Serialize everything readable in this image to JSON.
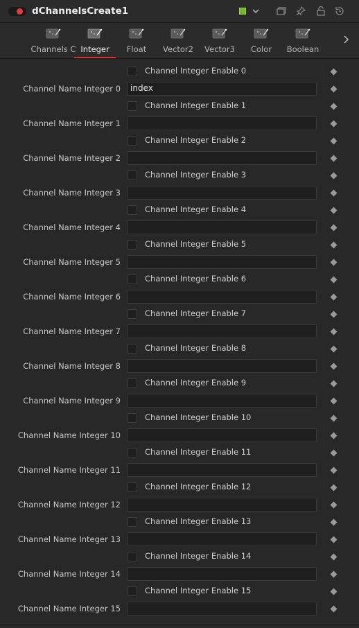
{
  "header": {
    "title": "dChannelsCreate1",
    "swatch_color": "#78b82a",
    "icons": [
      "chevron-down-icon",
      "windows-icon",
      "pin-icon",
      "lock-icon",
      "reset-icon"
    ]
  },
  "tabs": [
    {
      "label": "Channels C",
      "active": false
    },
    {
      "label": "Integer",
      "active": true
    },
    {
      "label": "Float",
      "active": false
    },
    {
      "label": "Vector2",
      "active": false
    },
    {
      "label": "Vector3",
      "active": false
    },
    {
      "label": "Color",
      "active": false
    },
    {
      "label": "Boolean",
      "active": false
    }
  ],
  "channels": [
    {
      "enable_label": "Channel Integer Enable 0",
      "name_label": "Channel Name Integer 0",
      "name_value": "index"
    },
    {
      "enable_label": "Channel Integer Enable 1",
      "name_label": "Channel Name Integer 1",
      "name_value": ""
    },
    {
      "enable_label": "Channel Integer Enable 2",
      "name_label": "Channel Name Integer 2",
      "name_value": ""
    },
    {
      "enable_label": "Channel Integer Enable 3",
      "name_label": "Channel Name Integer 3",
      "name_value": ""
    },
    {
      "enable_label": "Channel Integer Enable 4",
      "name_label": "Channel Name Integer 4",
      "name_value": ""
    },
    {
      "enable_label": "Channel Integer Enable 5",
      "name_label": "Channel Name Integer 5",
      "name_value": ""
    },
    {
      "enable_label": "Channel Integer Enable 6",
      "name_label": "Channel Name Integer 6",
      "name_value": ""
    },
    {
      "enable_label": "Channel Integer Enable 7",
      "name_label": "Channel Name Integer 7",
      "name_value": ""
    },
    {
      "enable_label": "Channel Integer Enable 8",
      "name_label": "Channel Name Integer 8",
      "name_value": ""
    },
    {
      "enable_label": "Channel Integer Enable 9",
      "name_label": "Channel Name Integer 9",
      "name_value": ""
    },
    {
      "enable_label": "Channel Integer Enable 10",
      "name_label": "Channel Name Integer 10",
      "name_value": ""
    },
    {
      "enable_label": "Channel Integer Enable 11",
      "name_label": "Channel Name Integer 11",
      "name_value": ""
    },
    {
      "enable_label": "Channel Integer Enable 12",
      "name_label": "Channel Name Integer 12",
      "name_value": ""
    },
    {
      "enable_label": "Channel Integer Enable 13",
      "name_label": "Channel Name Integer 13",
      "name_value": ""
    },
    {
      "enable_label": "Channel Integer Enable 14",
      "name_label": "Channel Name Integer 14",
      "name_value": ""
    },
    {
      "enable_label": "Channel Integer Enable 15",
      "name_label": "Channel Name Integer 15",
      "name_value": ""
    }
  ]
}
